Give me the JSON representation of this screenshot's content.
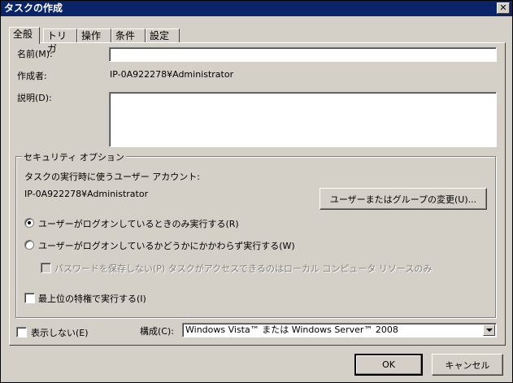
{
  "window": {
    "title": "タスクの作成",
    "close_glyph": "✕"
  },
  "tabs": [
    {
      "label": "全般",
      "active": true
    },
    {
      "label": "トリガ"
    },
    {
      "label": "操作"
    },
    {
      "label": "条件"
    },
    {
      "label": "設定"
    }
  ],
  "general": {
    "name_label": "名前(M):",
    "name_value": "",
    "author_label": "作成者:",
    "author_value": "IP-0A922278¥Administrator",
    "description_label": "説明(D):",
    "description_value": ""
  },
  "security": {
    "group_title": "セキュリティ オプション",
    "account_label": "タスクの実行時に使うユーザー アカウント:",
    "account_value": "IP-0A922278¥Administrator",
    "change_button": "ユーザーまたはグループの変更(U)...",
    "radio_logged_on": "ユーザーがログオンしているときのみ実行する(R)",
    "radio_logged_on_selected": true,
    "radio_whether": "ユーザーがログオンしているかどうかにかかわらず実行する(W)",
    "no_password_label": "パスワードを保存しない(P) タスクがアクセスできるのはローカル コンピュータ リソースのみ",
    "highest_priv_label": "最上位の特権で実行する(I)"
  },
  "bottom": {
    "hidden_label": "表示しない(E)",
    "configure_label": "構成(C):",
    "configure_value": "Windows Vista™ または Windows Server™ 2008"
  },
  "buttons": {
    "ok": "OK",
    "cancel": "キャンセル"
  }
}
